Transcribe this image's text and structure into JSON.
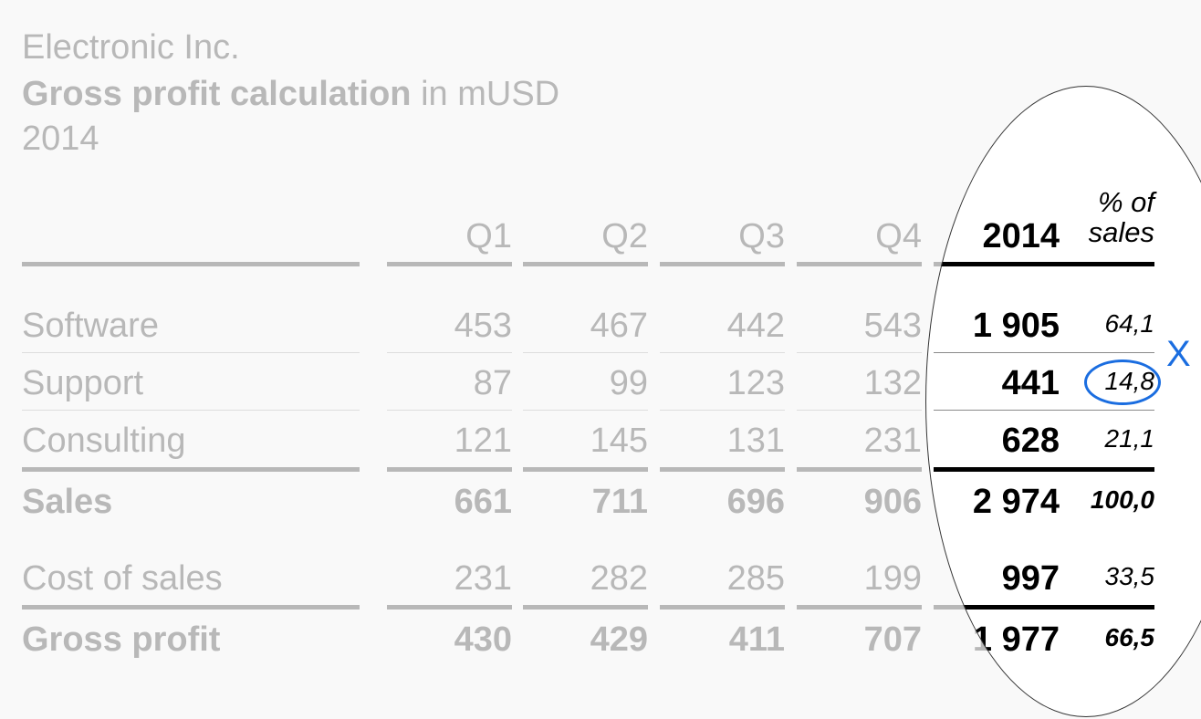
{
  "title": {
    "company": "Electronic Inc.",
    "report_bold": "Gross profit calculation",
    "report_unit": " in mUSD",
    "year": "2014"
  },
  "columns": {
    "q1": "Q1",
    "q2": "Q2",
    "q3": "Q3",
    "q4": "Q4",
    "total": "2014",
    "pct_line1": "% of",
    "pct_line2": "sales"
  },
  "rows": [
    {
      "label": "Software",
      "q1": "453",
      "q2": "467",
      "q3": "442",
      "q4": "543",
      "total": "1 905",
      "pct": "64,1",
      "bold": false
    },
    {
      "label": "Support",
      "q1": "87",
      "q2": "99",
      "q3": "123",
      "q4": "132",
      "total": "441",
      "pct": "14,8",
      "bold": false
    },
    {
      "label": "Consulting",
      "q1": "121",
      "q2": "145",
      "q3": "131",
      "q4": "231",
      "total": "628",
      "pct": "21,1",
      "bold": false
    },
    {
      "label": "Sales",
      "q1": "661",
      "q2": "711",
      "q3": "696",
      "q4": "906",
      "total": "2 974",
      "pct": "100,0",
      "bold": true
    },
    {
      "label": "Cost of sales",
      "q1": "231",
      "q2": "282",
      "q3": "285",
      "q4": "199",
      "total": "997",
      "pct": "33,5",
      "bold": false
    },
    {
      "label": "Gross profit",
      "q1": "430",
      "q2": "429",
      "q3": "411",
      "q4": "707",
      "total": "1 977",
      "pct": "66,5",
      "bold": true
    }
  ],
  "annotation": {
    "highlighted_cell": "14,8",
    "mark": "X",
    "color": "#1a6de0"
  },
  "colors": {
    "faded_text": "#b8b8b8",
    "focus_text": "#000000",
    "background": "#f9f9f9",
    "spotlight": "#ffffff"
  }
}
